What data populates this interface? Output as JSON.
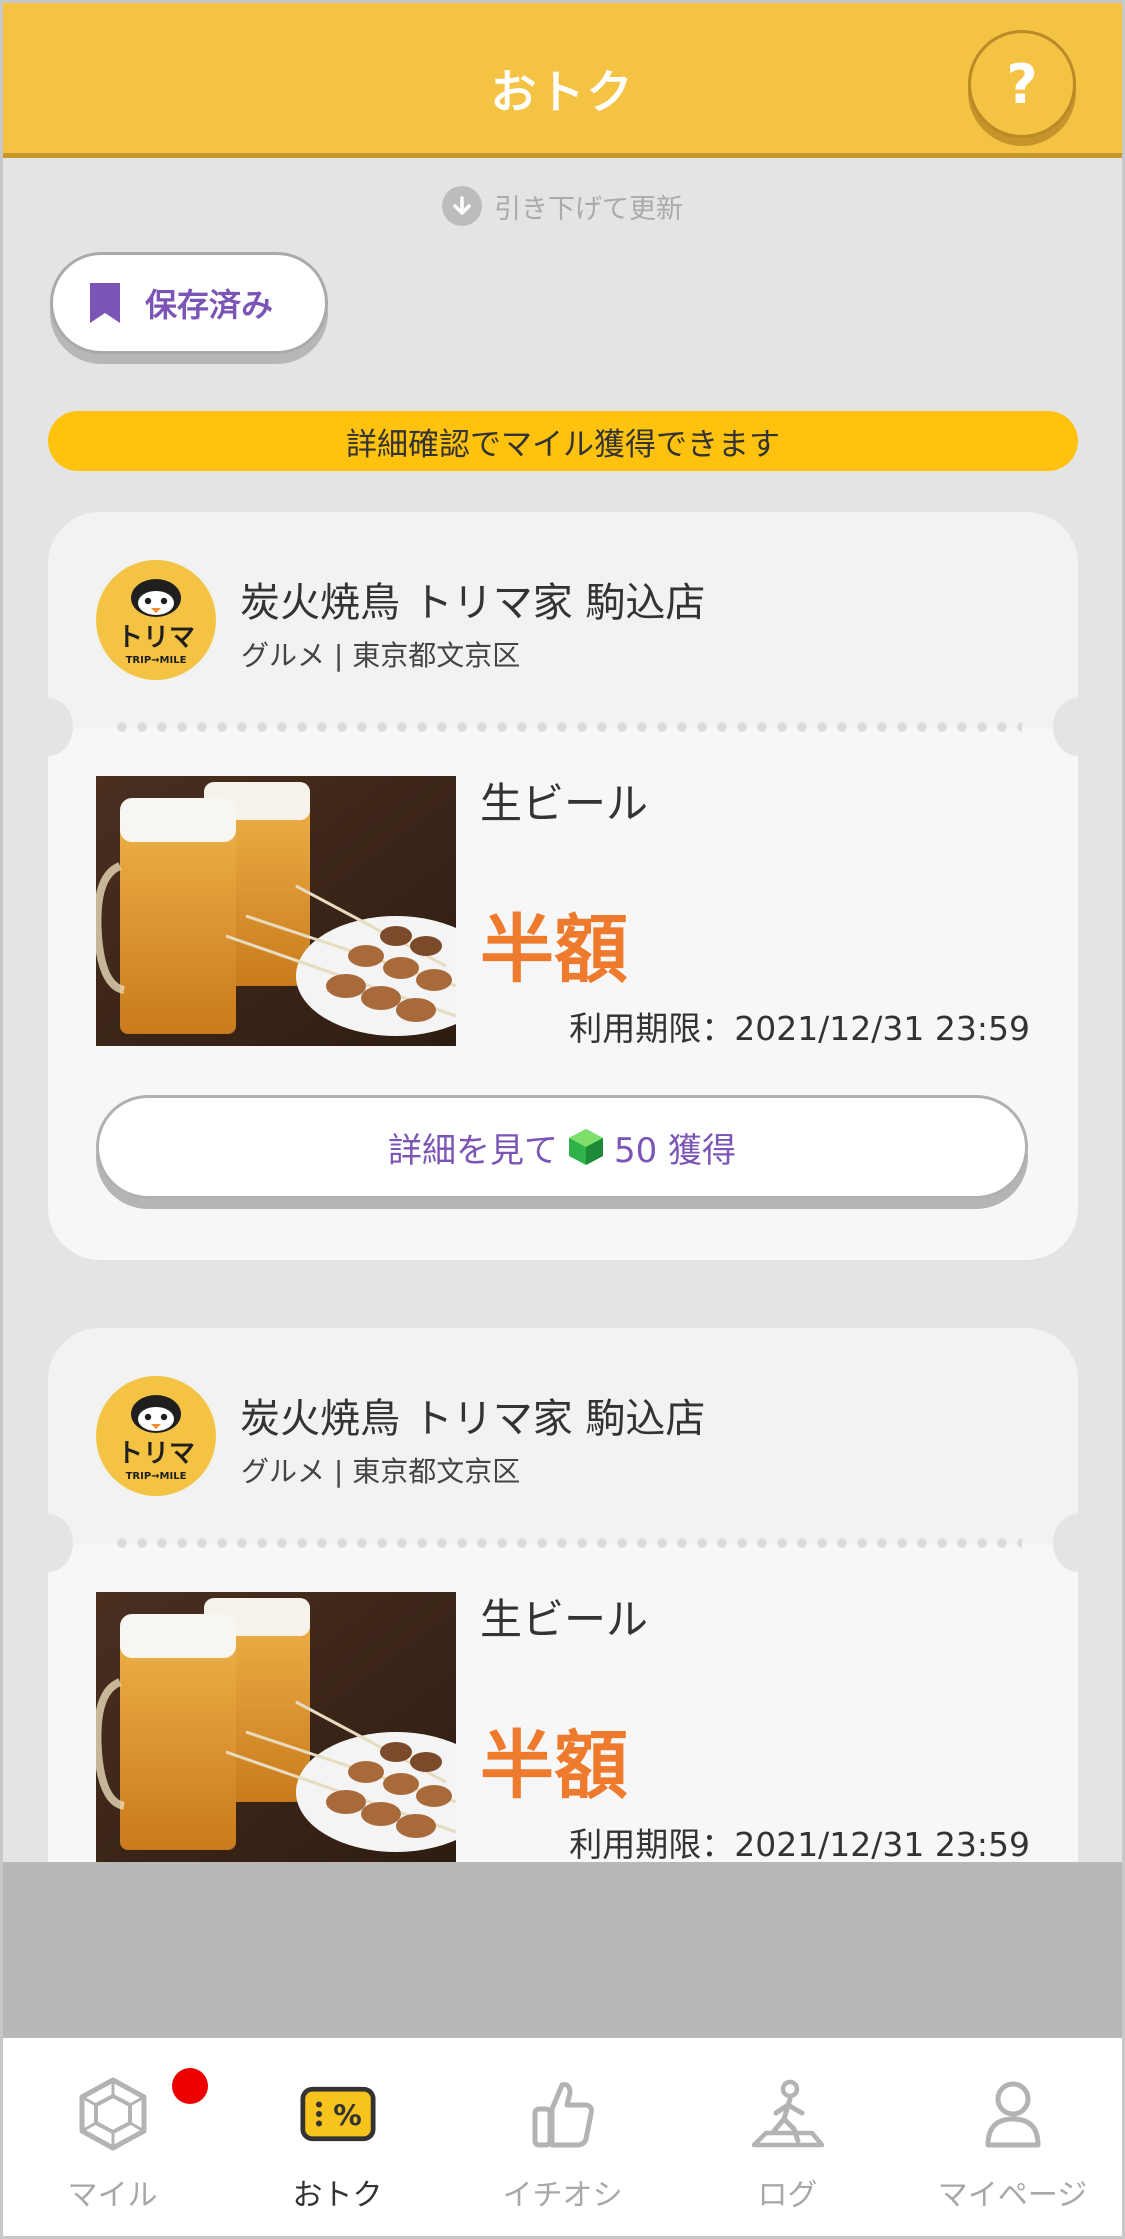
{
  "header": {
    "title": "おトク",
    "help_label": "?"
  },
  "refresh": {
    "label": "引き下げて更新"
  },
  "saved": {
    "label": "保存済み"
  },
  "banner": {
    "text": "詳細確認でマイル獲得できます"
  },
  "cards": [
    {
      "shop_name": "炭火焼鳥 トリマ家 駒込店",
      "category": "グルメ | 東京都文京区",
      "logo_text": "トリマ",
      "logo_sub": "TRIP→MILE",
      "item_name": "生ビール",
      "discount": "半額",
      "expiry": "利用期限：2021/12/31 23:59",
      "detail_prefix": "詳細を見て",
      "detail_suffix": "50 獲得"
    },
    {
      "shop_name": "炭火焼鳥 トリマ家 駒込店",
      "category": "グルメ | 東京都文京区",
      "logo_text": "トリマ",
      "logo_sub": "TRIP→MILE",
      "item_name": "生ビール",
      "discount": "半額",
      "expiry": "利用期限：2021/12/31 23:59"
    }
  ],
  "nav": [
    {
      "label": "マイル",
      "icon": "gem-icon",
      "active": false,
      "badge": true
    },
    {
      "label": "おトク",
      "icon": "coupon-percent-icon",
      "active": true
    },
    {
      "label": "イチオシ",
      "icon": "thumbs-up-icon",
      "active": false
    },
    {
      "label": "ログ",
      "icon": "walking-icon",
      "active": false
    },
    {
      "label": "マイページ",
      "icon": "person-icon",
      "active": false
    }
  ],
  "colors": {
    "header": "#f4c344",
    "banner": "#ffc20e",
    "accent_purple": "#7b55b5",
    "discount_orange": "#ee7a2d",
    "badge_red": "#ee0000"
  }
}
